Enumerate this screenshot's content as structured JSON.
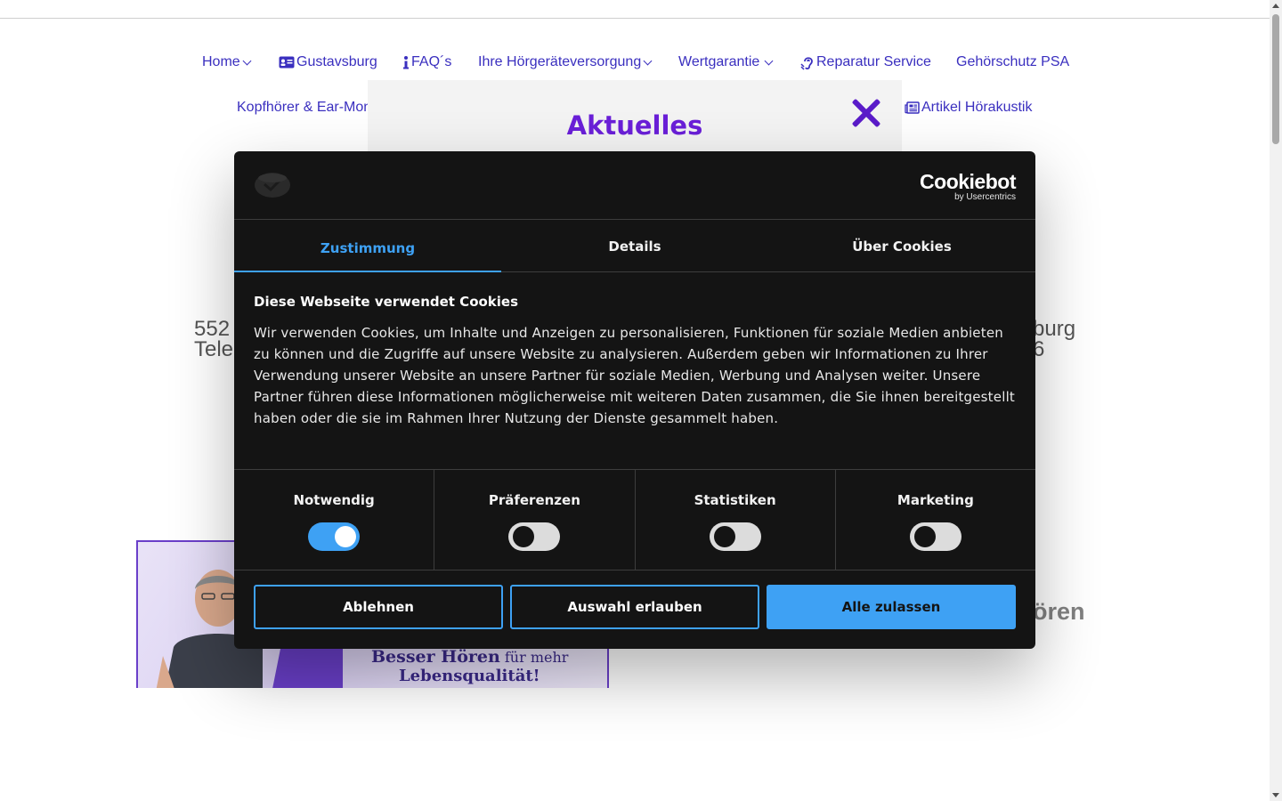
{
  "nav": {
    "row1": [
      {
        "label": "Home",
        "dropdown": true,
        "icon": ""
      },
      {
        "label": "Gustavsburg",
        "dropdown": false,
        "icon": "id-card-icon"
      },
      {
        "label": "FAQ´s",
        "dropdown": false,
        "icon": "info-icon"
      },
      {
        "label": "Ihre Hörgeräteversorgung",
        "dropdown": true,
        "icon": ""
      },
      {
        "label": "Wertgarantie",
        "dropdown": true,
        "icon": ""
      },
      {
        "label": "Reparatur Service",
        "dropdown": false,
        "icon": "ear-icon"
      },
      {
        "label": "Gehörschutz PSA",
        "dropdown": false,
        "icon": ""
      }
    ],
    "row2": [
      {
        "label": "Kopfhörer & Ear-Mon",
        "dropdown": false,
        "icon": ""
      },
      {
        "label": "Artikel Hörakustik",
        "dropdown": false,
        "icon": "newspaper-icon"
      }
    ]
  },
  "popup": {
    "title": "Aktuelles"
  },
  "background": {
    "addr_left_1": "552",
    "addr_left_2": "Tele",
    "addr_right_1": "burg",
    "addr_right_2": "6",
    "heading_right": "ören",
    "banner_line1_bold": "Besser Hören",
    "banner_line1_normal": " für mehr",
    "banner_line2": "Lebensqualität!"
  },
  "cookie": {
    "brand_name": "Cookiebot",
    "brand_sub": "by Usercentrics",
    "tabs": [
      "Zustimmung",
      "Details",
      "Über Cookies"
    ],
    "active_tab": 0,
    "title": "Diese Webseite verwendet Cookies",
    "text": "Wir verwenden Cookies, um Inhalte und Anzeigen zu personalisieren, Funktionen für soziale Medien anbieten zu können und die Zugriffe auf unsere Website zu analysieren. Außerdem geben wir Informationen zu Ihrer Verwendung unserer Website an unsere Partner für soziale Medien, Werbung und Analysen weiter. Unsere Partner führen diese Informationen möglicherweise mit weiteren Daten zusammen, die Sie ihnen bereitgestellt haben oder die sie im Rahmen Ihrer Nutzung der Dienste gesammelt haben.",
    "toggles": [
      {
        "label": "Notwendig",
        "on": true
      },
      {
        "label": "Präferenzen",
        "on": false
      },
      {
        "label": "Statistiken",
        "on": false
      },
      {
        "label": "Marketing",
        "on": false
      }
    ],
    "buttons": {
      "decline": "Ablehnen",
      "allow_selection": "Auswahl erlauben",
      "allow_all": "Alle zulassen"
    }
  },
  "colors": {
    "nav_link": "#3a2fbf",
    "accent_purple": "#6a1fd8",
    "cookie_bg": "#141414",
    "cookie_accent": "#3ea1f4"
  }
}
